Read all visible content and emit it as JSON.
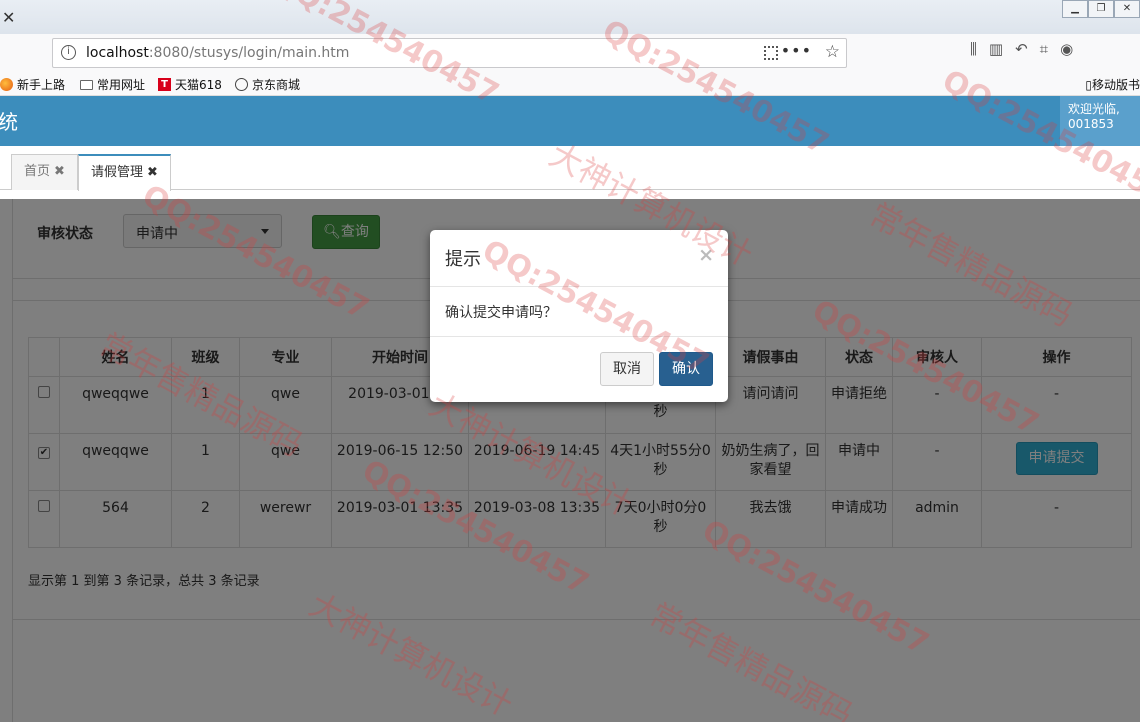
{
  "browser": {
    "url_host": "localhost",
    "url_path": ":8080/stusys/login/main.htm",
    "bookmarks": [
      "新手上路",
      "常用网址",
      "天猫618",
      "京东商城"
    ],
    "mobile_bookmarks": "移动版书",
    "tmall_letter": "T"
  },
  "header": {
    "title_fragment": "统",
    "welcome_line1": "欢迎光临,",
    "welcome_line2": "001853"
  },
  "tabs": [
    {
      "label": "首页"
    },
    {
      "label": "请假管理"
    }
  ],
  "filter": {
    "label": "审核状态",
    "selected": "申请中",
    "query_button": "查询"
  },
  "table": {
    "headers": [
      "",
      "姓名",
      "班级",
      "专业",
      "开始时间",
      "",
      "",
      "请假事由",
      "状态",
      "审核人",
      "操作"
    ],
    "rows": [
      {
        "checked": false,
        "name": "qweqqwe",
        "class": "1",
        "major": "qwe",
        "start": "2019-03-01 13",
        "end": "",
        "duration": "秒",
        "reason": "请问请问",
        "status": "申请拒绝",
        "reviewer": "-",
        "action": "-"
      },
      {
        "checked": true,
        "name": "qweqqwe",
        "class": "1",
        "major": "qwe",
        "start": "2019-06-15 12:50",
        "end": "2019-06-19 14:45",
        "duration": "4天1小时55分0秒",
        "reason": "奶奶生病了，回家看望",
        "status": "申请中",
        "reviewer": "-",
        "action": "申请提交"
      },
      {
        "checked": false,
        "name": "564",
        "class": "2",
        "major": "werewr",
        "start": "2019-03-01 13:35",
        "end": "2019-03-08 13:35",
        "duration": "7天0小时0分0秒",
        "reason": "我去饿",
        "status": "申请成功",
        "reviewer": "admin",
        "action": "-"
      }
    ],
    "record_info": "显示第 1 到第 3 条记录，总共 3 条记录"
  },
  "modal": {
    "title": "提示",
    "close": "×",
    "message": "确认提交申请吗？",
    "cancel": "取消",
    "confirm": "确认"
  },
  "watermark": {
    "qq": "QQ:254540457",
    "text1": "常年售精品源码",
    "text2": "大神计算机设计"
  }
}
